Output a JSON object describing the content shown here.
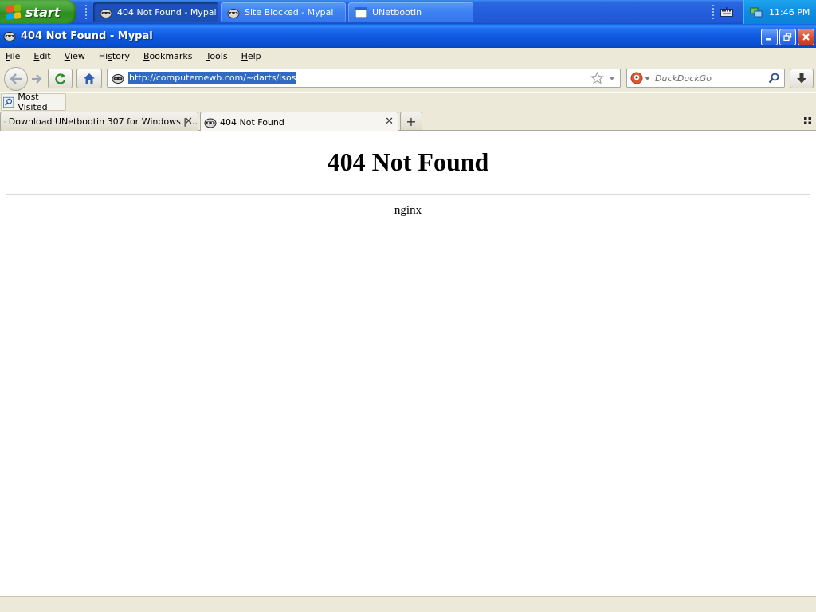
{
  "taskbar": {
    "start_label": "start",
    "tasks": [
      {
        "label": "404 Not Found - Mypal",
        "active": true,
        "icon": "mypal-raccoon-icon"
      },
      {
        "label": "Site Blocked - Mypal",
        "active": false,
        "icon": "mypal-raccoon-icon"
      },
      {
        "label": "UNetbootin",
        "active": false,
        "icon": "window-icon"
      }
    ],
    "clock": "11:46 PM"
  },
  "window": {
    "title": "404 Not Found - Mypal"
  },
  "menu": {
    "items": [
      {
        "label": "File",
        "underline": "F"
      },
      {
        "label": "Edit",
        "underline": "E"
      },
      {
        "label": "View",
        "underline": "V"
      },
      {
        "label": "History",
        "underline": "H"
      },
      {
        "label": "Bookmarks",
        "underline": "B"
      },
      {
        "label": "Tools",
        "underline": "T"
      },
      {
        "label": "Help",
        "underline": "H"
      }
    ]
  },
  "navbar": {
    "url": "http://computernewb.com/~darts/isos",
    "search_placeholder": "DuckDuckGo"
  },
  "bookmarks": {
    "most_visited": "Most Visited"
  },
  "tabs": [
    {
      "label": "Download UNetbootin 307 for Windows | ...",
      "selected": false
    },
    {
      "label": "404 Not Found",
      "selected": true
    }
  ],
  "page": {
    "heading": "404 Not Found",
    "footer": "nginx"
  },
  "colors": {
    "taskbar_blue": "#245edc",
    "start_green": "#3c9a2e",
    "chrome_beige": "#ece9d8",
    "selection_blue": "#316ac5"
  }
}
